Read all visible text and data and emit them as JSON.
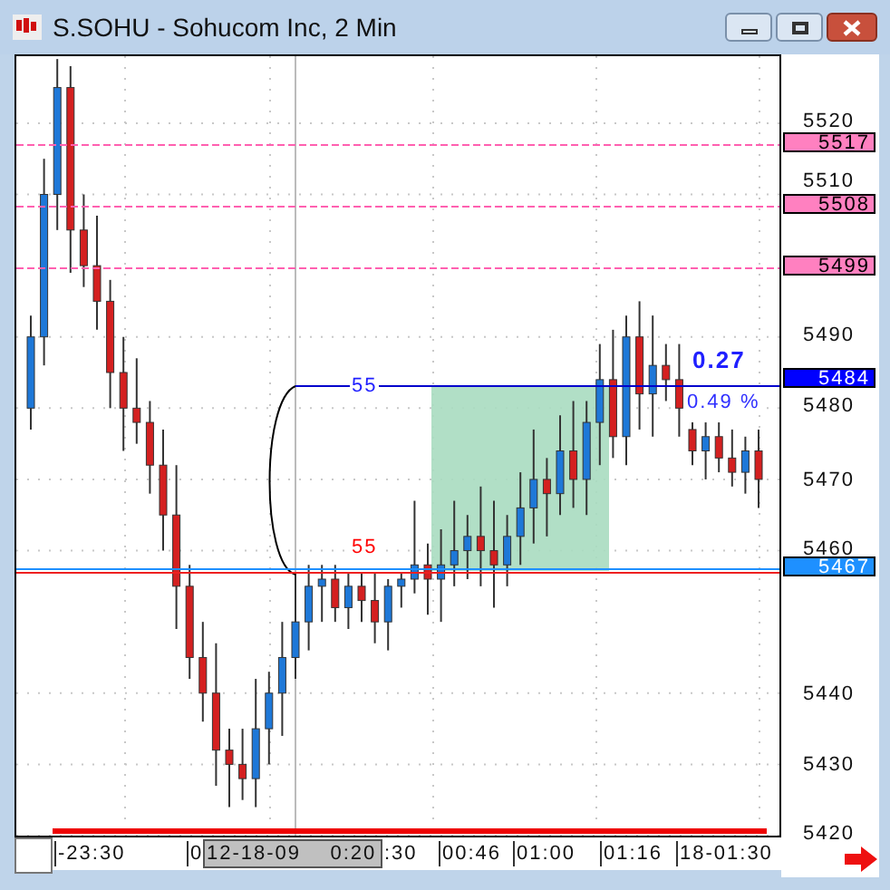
{
  "window": {
    "title": "S.SOHU - Sohucom Inc, 2 Min"
  },
  "chart": {
    "chart_data": {
      "type": "candlestick",
      "ylim": [
        5420,
        5529.4
      ],
      "yticks": [
        5520,
        5510,
        5490,
        5480,
        5470,
        5460,
        5440,
        5430,
        5420
      ],
      "grid": true,
      "categories": [
        null,
        null,
        null,
        null,
        null,
        null,
        null,
        null,
        null,
        null,
        null,
        null,
        null,
        null,
        null,
        null,
        null,
        null,
        null,
        null,
        null,
        null,
        null,
        null,
        null,
        null,
        null,
        null,
        null,
        null,
        null,
        null,
        null,
        null,
        null,
        null,
        null,
        null,
        null,
        null,
        null,
        null,
        null,
        null,
        null,
        null,
        null,
        null,
        null,
        null,
        null,
        null,
        null,
        null,
        null,
        null
      ],
      "ohlc": [
        [
          5480,
          5493,
          5477,
          5490
        ],
        [
          5490,
          5515,
          5486,
          5510
        ],
        [
          5510,
          5529,
          5505,
          5525
        ],
        [
          5525,
          5528,
          5499,
          5505
        ],
        [
          5505,
          5510,
          5497,
          5500
        ],
        [
          5500,
          5507,
          5491,
          5495
        ],
        [
          5495,
          5498,
          5480,
          5485
        ],
        [
          5485,
          5490,
          5474,
          5480
        ],
        [
          5480,
          5487,
          5475,
          5478
        ],
        [
          5478,
          5481,
          5468,
          5472
        ],
        [
          5472,
          5477,
          5460,
          5465
        ],
        [
          5465,
          5472,
          5449,
          5455
        ],
        [
          5455,
          5458,
          5442,
          5445
        ],
        [
          5445,
          5450,
          5436,
          5440
        ],
        [
          5440,
          5447,
          5427,
          5432
        ],
        [
          5432,
          5435,
          5424,
          5430
        ],
        [
          5430,
          5435,
          5425,
          5428
        ],
        [
          5428,
          5442,
          5424,
          5435
        ],
        [
          5435,
          5443,
          5430,
          5440
        ],
        [
          5440,
          5450,
          5434,
          5445
        ],
        [
          5445,
          5457,
          5442,
          5450
        ],
        [
          5450,
          5458,
          5446,
          5455
        ],
        [
          5455,
          5458,
          5450,
          5456
        ],
        [
          5456,
          5458,
          5450,
          5452
        ],
        [
          5452,
          5457,
          5449,
          5455
        ],
        [
          5455,
          5457,
          5450,
          5453
        ],
        [
          5453,
          5457,
          5447,
          5450
        ],
        [
          5450,
          5456,
          5446,
          5455
        ],
        [
          5455,
          5457,
          5452,
          5456
        ],
        [
          5456,
          5467,
          5454,
          5458
        ],
        [
          5458,
          5461,
          5451,
          5456
        ],
        [
          5456,
          5463,
          5450,
          5458
        ],
        [
          5458,
          5467,
          5455,
          5460
        ],
        [
          5460,
          5465,
          5456,
          5462
        ],
        [
          5462,
          5469,
          5455,
          5460
        ],
        [
          5460,
          5467,
          5452,
          5458
        ],
        [
          5458,
          5465,
          5455,
          5462
        ],
        [
          5462,
          5471,
          5458,
          5466
        ],
        [
          5466,
          5477,
          5461,
          5470
        ],
        [
          5470,
          5473,
          5462,
          5468
        ],
        [
          5468,
          5479,
          5465,
          5474
        ],
        [
          5474,
          5481,
          5466,
          5470
        ],
        [
          5470,
          5481,
          5465,
          5478
        ],
        [
          5478,
          5489,
          5472,
          5484
        ],
        [
          5484,
          5491,
          5473,
          5476
        ],
        [
          5476,
          5493,
          5472,
          5490
        ],
        [
          5490,
          5495,
          5477,
          5482
        ],
        [
          5482,
          5493,
          5476,
          5486
        ],
        [
          5486,
          5489,
          5481,
          5484
        ],
        [
          5484,
          5489,
          5476,
          5480
        ],
        [
          5477,
          5478,
          5472,
          5474
        ],
        [
          5474,
          5478,
          5470,
          5476
        ],
        [
          5476,
          5478,
          5471,
          5473
        ],
        [
          5473,
          5477,
          5469,
          5471
        ],
        [
          5471,
          5476,
          5468,
          5474
        ],
        [
          5474,
          5477,
          5466,
          5470
        ]
      ]
    }
  },
  "markers": [
    {
      "label": "5517",
      "kind": "alert",
      "color": "#ff80c0"
    },
    {
      "label": "5508",
      "kind": "alert",
      "color": "#ff80c0"
    },
    {
      "label": "5499",
      "kind": "alert",
      "color": "#ff80c0"
    },
    {
      "label": "5484",
      "kind": "last",
      "color": "#0000ff"
    },
    {
      "label": "5467",
      "kind": "cursor",
      "color": "#1e90ff"
    }
  ],
  "range_labels": [
    {
      "text": "55",
      "color": "#2020ff"
    },
    {
      "text": "55",
      "color": "#ff0000"
    }
  ],
  "change": {
    "value": "0.27",
    "percent": "0.49 %"
  },
  "time_axis": {
    "labels": [
      "-23:30",
      "0",
      ":30",
      "00:46",
      "01:00",
      "01:16",
      "18-01:30"
    ],
    "cursor_label": "12-18-09    0:20"
  }
}
